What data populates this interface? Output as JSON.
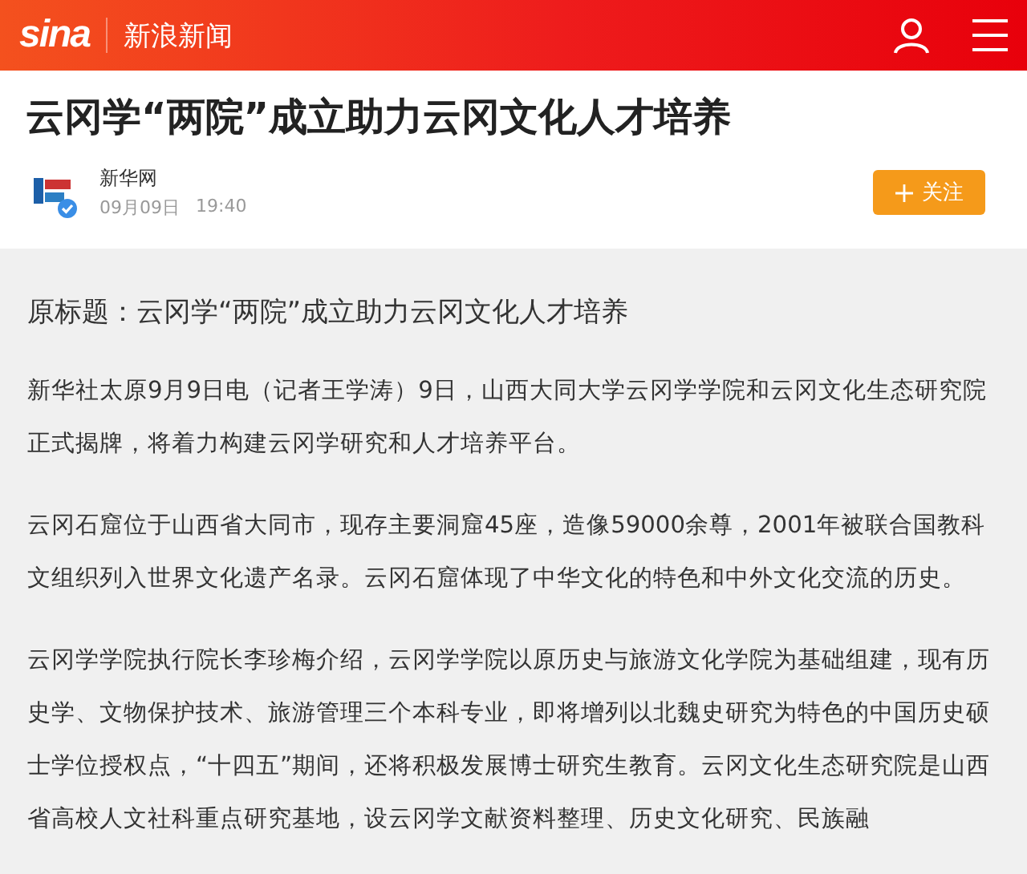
{
  "header": {
    "logo": "sina",
    "channel": "新浪新闻"
  },
  "article": {
    "title": "云冈学“两院”成立助力云冈文化人才培养",
    "source": {
      "name": "新华网",
      "date": "09月09日",
      "time": "19:40",
      "verified": true
    },
    "follow_button": {
      "label": "关注"
    },
    "original_title": "原标题：云冈学“两院”成立助力云冈文化人才培养",
    "paragraphs": [
      "新华社太原9月9日电（记者王学涛）9日，山西大同大学云冈学学院和云冈文化生态研究院正式揭牌，将着力构建云冈学研究和人才培养平台。",
      "云冈石窟位于山西省大同市，现存主要洞窟45座，造像59000余尊，2001年被联合国教科文组织列入世界文化遗产名录。云冈石窟体现了中华文化的特色和中外文化交流的历史。",
      "云冈学学院执行院长李珍梅介绍，云冈学学院以原历史与旅游文化学院为基础组建，现有历史学、文物保护技术、旅游管理三个本科专业，即将增列以北魏史研究为特色的中国历史硕士学位授权点，“十四五”期间，还将积极发展博士研究生教育。云冈文化生态研究院是山西省高校人文社科重点研究基地，设云冈学文献资料整理、历史文化研究、民族融"
    ]
  }
}
